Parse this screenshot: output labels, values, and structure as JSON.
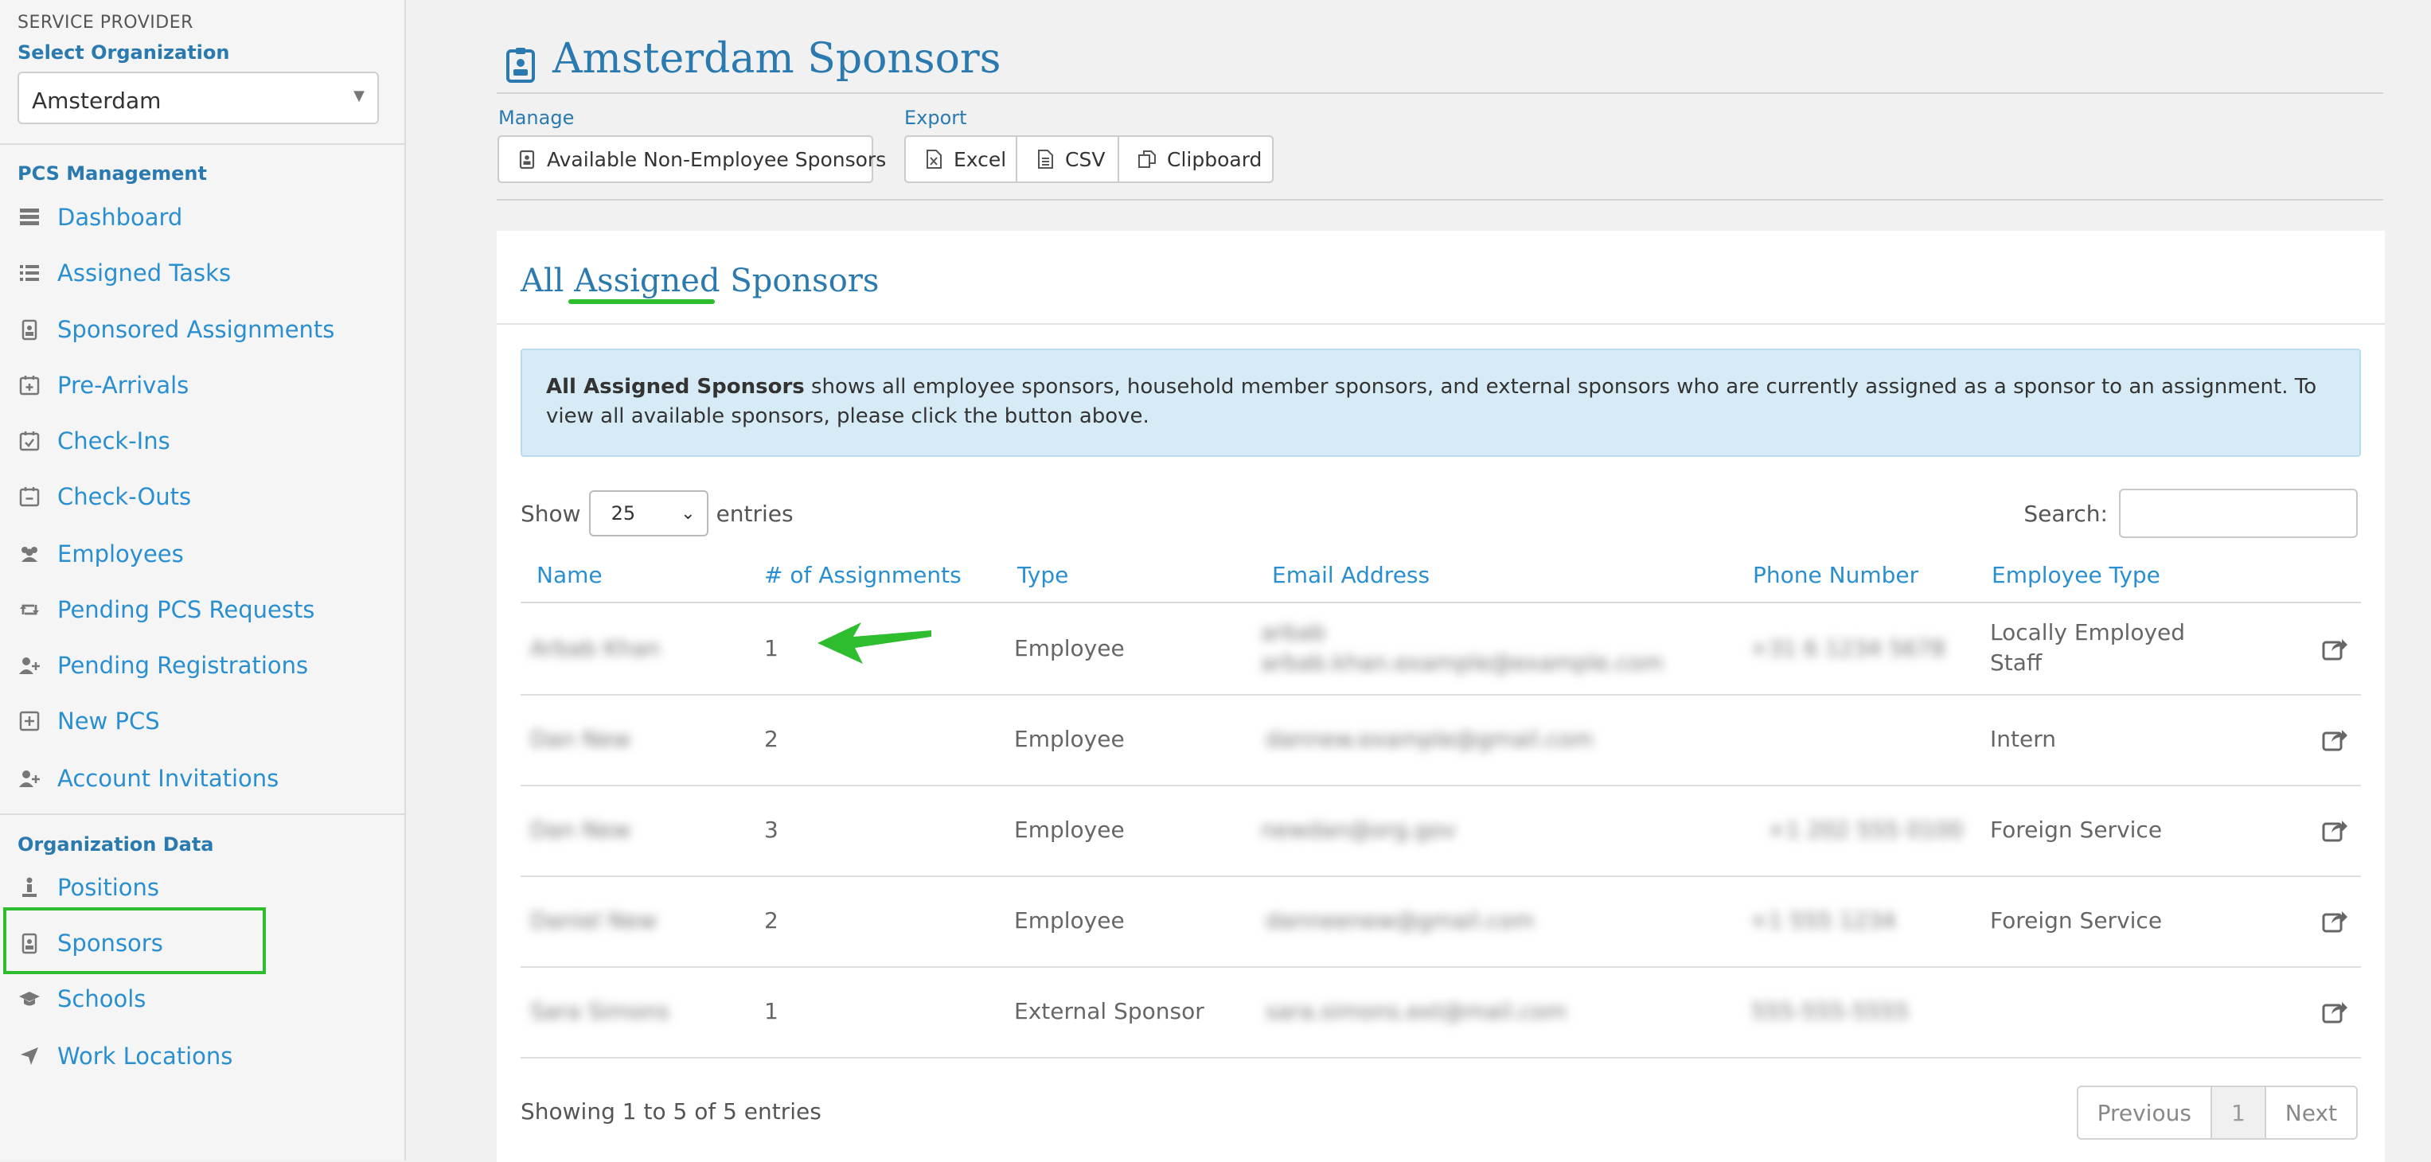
{
  "sidebar": {
    "service_provider_label": "SERVICE PROVIDER",
    "select_org_label": "Select Organization",
    "org_value": "Amsterdam",
    "section_pcs": "PCS Management",
    "section_org": "Organization Data",
    "pcs_items": [
      {
        "label": "Dashboard",
        "icon": "dashboard-icon"
      },
      {
        "label": "Assigned Tasks",
        "icon": "list-icon"
      },
      {
        "label": "Sponsored Assignments",
        "icon": "badge-icon"
      },
      {
        "label": "Pre-Arrivals",
        "icon": "calendar-plus-icon"
      },
      {
        "label": "Check-Ins",
        "icon": "calendar-check-icon"
      },
      {
        "label": "Check-Outs",
        "icon": "calendar-minus-icon"
      },
      {
        "label": "Employees",
        "icon": "users-icon"
      },
      {
        "label": "Pending PCS Requests",
        "icon": "retweet-icon"
      },
      {
        "label": "Pending Registrations",
        "icon": "user-plus-icon"
      },
      {
        "label": "New PCS",
        "icon": "plus-square-icon"
      },
      {
        "label": "Account Invitations",
        "icon": "user-plus-icon"
      }
    ],
    "org_items": [
      {
        "label": "Positions",
        "icon": "person-icon"
      },
      {
        "label": "Sponsors",
        "icon": "badge-icon"
      },
      {
        "label": "Schools",
        "icon": "graduation-cap-icon"
      },
      {
        "label": "Work Locations",
        "icon": "location-arrow-icon"
      }
    ]
  },
  "header": {
    "title": "Amsterdam Sponsors",
    "manage_label": "Manage",
    "export_label": "Export",
    "manage_button": "Available Non-Employee Sponsors",
    "export_buttons": [
      "Excel",
      "CSV",
      "Clipboard"
    ]
  },
  "panel": {
    "title_prefix": "All",
    "title_highlight": "Assigned",
    "title_suffix": "Sponsors",
    "info_bold": "All Assigned Sponsors",
    "info_text": " shows all employee sponsors, household member sponsors, and external sponsors who are currently assigned as a sponsor to an assignment. To view all available sponsors, please click the button above.",
    "show_label": "Show",
    "show_value": "25",
    "entries_label": "entries",
    "search_label": "Search:",
    "search_value": ""
  },
  "table": {
    "columns": [
      "Name",
      "# of Assignments",
      "Type",
      "Email Address",
      "Phone Number",
      "Employee Type"
    ],
    "rows": [
      {
        "name": "Arbab Khan",
        "assignments": "1",
        "type": "Employee",
        "email": "arbab",
        "email2": "arbab.khan.example@example.com",
        "phone": "+31 6 1234 5678",
        "emp_type_1": "Locally Employed",
        "emp_type_2": "Staff"
      },
      {
        "name": "Dan New",
        "assignments": "2",
        "type": "Employee",
        "email": "dannew.example@gmail.com",
        "email2": "",
        "phone": "",
        "emp_type_1": "Intern",
        "emp_type_2": ""
      },
      {
        "name": "Dan New",
        "assignments": "3",
        "type": "Employee",
        "email": "newdan@org.gov",
        "email2": "",
        "phone": "+1 202 555 0100",
        "emp_type_1": "Foreign Service",
        "emp_type_2": ""
      },
      {
        "name": "Daniel New",
        "assignments": "2",
        "type": "Employee",
        "email": "danneenew@gmail.com",
        "email2": "",
        "phone": "+1 555 1234",
        "emp_type_1": "Foreign Service",
        "emp_type_2": ""
      },
      {
        "name": "Sara Simons",
        "assignments": "1",
        "type": "External Sponsor",
        "email": "sara.simons.ext@mail.com",
        "email2": "",
        "phone": "555-555-5555",
        "emp_type_1": "",
        "emp_type_2": ""
      }
    ]
  },
  "footer": {
    "showing": "Showing 1 to 5 of 5 entries",
    "prev": "Previous",
    "page": "1",
    "next": "Next"
  },
  "colors": {
    "accent": "#2a7ab0",
    "link": "#2a8fd0",
    "highlight_green": "#2ebd2e",
    "info_bg": "#d6ebf5"
  }
}
